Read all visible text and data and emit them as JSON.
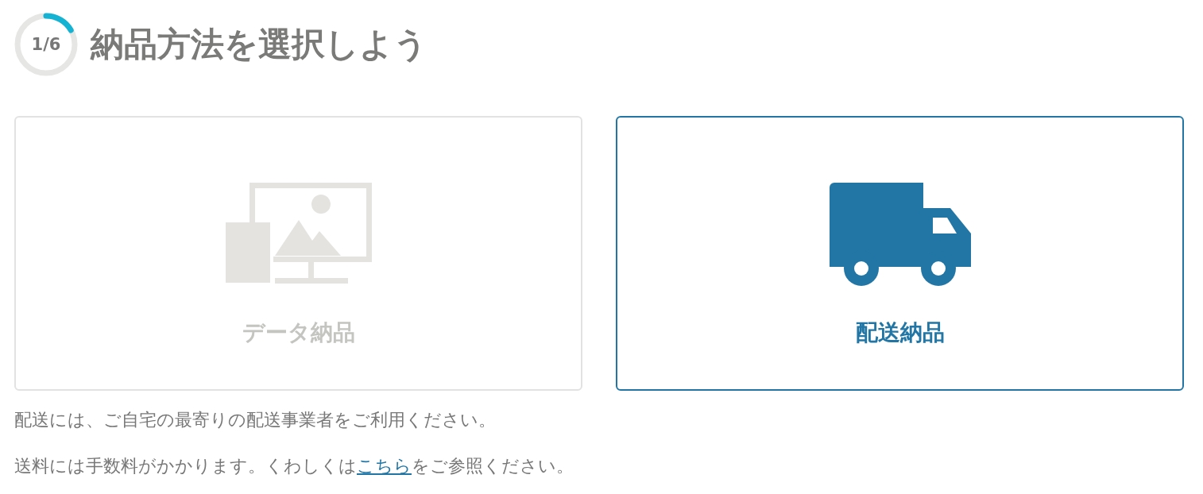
{
  "step": {
    "label": "1/6"
  },
  "title": "納品方法を選択しよう",
  "options": [
    {
      "kind": "data",
      "label": "データ納品",
      "selected": false
    },
    {
      "kind": "delivery",
      "label": "配送納品",
      "selected": true
    }
  ],
  "notes": [
    {
      "text": "配送には、ご自宅の最寄りの配送事業者をご利用ください。"
    },
    {
      "text": "送料には手数料がかかります。くわしくは",
      "link": "こちら",
      "after": "をご参照ください。"
    }
  ]
}
